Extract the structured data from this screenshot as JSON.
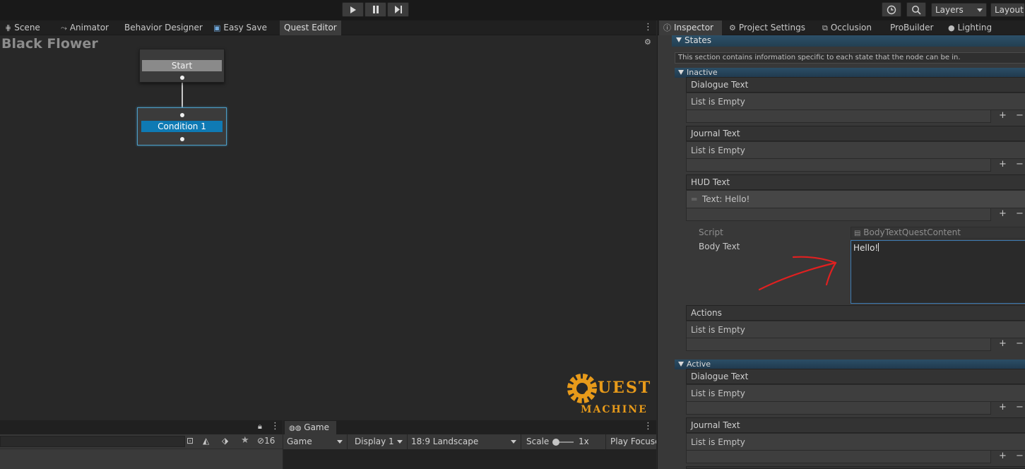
{
  "toolbar": {
    "play_icon": "play-icon",
    "pause_icon": "pause-icon",
    "step_icon": "step-icon",
    "history_icon": "history-icon",
    "search_icon": "search-icon",
    "layers_label": "Layers",
    "layout_label": "Layout"
  },
  "left_tabs": [
    {
      "label": "Scene",
      "icon": "scene-icon"
    },
    {
      "label": "Animator",
      "icon": "animator-icon"
    },
    {
      "label": "Behavior Designer"
    },
    {
      "label": "Easy Save",
      "icon": "save-icon"
    },
    {
      "label": "Quest Editor"
    }
  ],
  "right_tabs": [
    {
      "label": "Inspector",
      "icon": "info-icon"
    },
    {
      "label": "Project Settings",
      "icon": "gear-icon"
    },
    {
      "label": "Occlusion",
      "icon": "occlusion-icon"
    },
    {
      "label": "ProBuilder"
    },
    {
      "label": "Lighting",
      "icon": "lightbulb-icon"
    }
  ],
  "quest_editor": {
    "title": "Black Flower",
    "start_node": "Start",
    "condition_node": "Condition 1",
    "logo_text_1": "UEST",
    "logo_text_2": "MACHINE"
  },
  "inspector": {
    "states_label": "States",
    "states_help": "This section contains information specific to each state that the node can be in.",
    "inactive_label": "Inactive",
    "active_label": "Active",
    "empty_text": "List is Empty",
    "dialogue_text": "Dialogue Text",
    "journal_text": "Journal Text",
    "hud_text": "HUD Text",
    "hud_item": "Text: Hello!",
    "script_label": "Script",
    "script_value": "BodyTextQuestContent",
    "body_text_label": "Body Text",
    "body_text_value": "Hello!",
    "actions_label": "Actions",
    "plus": "+",
    "minus": "−",
    "annotation_color": "#e02020"
  },
  "bottom": {
    "hidden_count": "16",
    "game_tab": "Game",
    "game_dropdown": "Game",
    "display_dropdown": "Display 1",
    "aspect_dropdown": "18:9 Landscape",
    "scale_label": "Scale",
    "scale_value": "1x",
    "play_focused": "Play Focuse"
  }
}
